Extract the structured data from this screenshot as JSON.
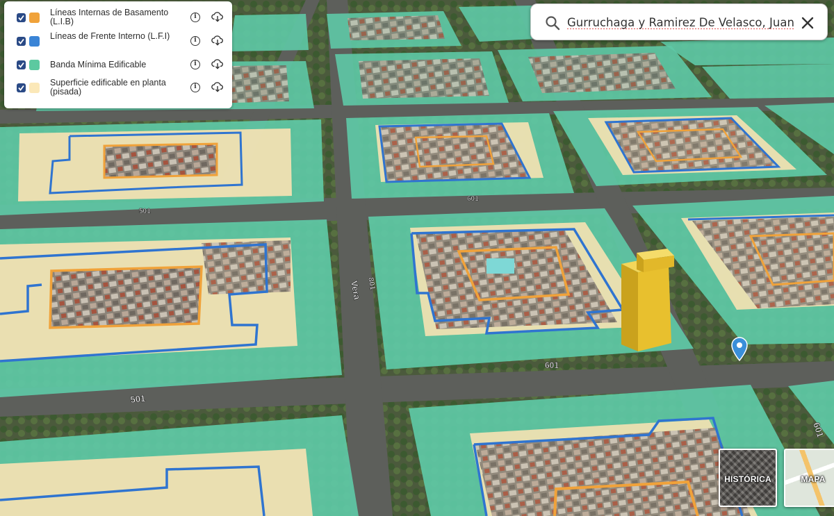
{
  "legend": {
    "items": [
      {
        "label": "Líneas Internas de Basamento (L.I.B)",
        "color": "#f0a23a",
        "checked": true
      },
      {
        "label": "Líneas de Frente Interno (L.F.I)",
        "color": "#3a84d6",
        "checked": true
      },
      {
        "label": "Banda Mínima Edificable",
        "color": "#5cc9a0",
        "checked": true
      },
      {
        "label": "Superficie edificable en planta (pisada)",
        "color": "#fbe8b8",
        "checked": true
      }
    ],
    "info_icon": "info-icon",
    "download_icon": "cloud-download-icon"
  },
  "search": {
    "value": "Gurruchaga y Ramirez De Velasco, Juan",
    "placeholder": "",
    "icon": "search-icon",
    "clear_icon": "close-icon"
  },
  "map": {
    "street_labels": [
      "601",
      "501",
      "601",
      "501",
      "801",
      "Vera",
      "601",
      "701"
    ],
    "colors": {
      "banda": "#5ec9a6",
      "superficie": "#f6e2b3",
      "lib": "#f0a23a",
      "lfi": "#2f74d0",
      "building": "#e8c02e",
      "marker": "#3a8fd9"
    }
  },
  "basemaps": [
    {
      "label": "HISTÓRICA"
    },
    {
      "label": "MAPA"
    }
  ]
}
